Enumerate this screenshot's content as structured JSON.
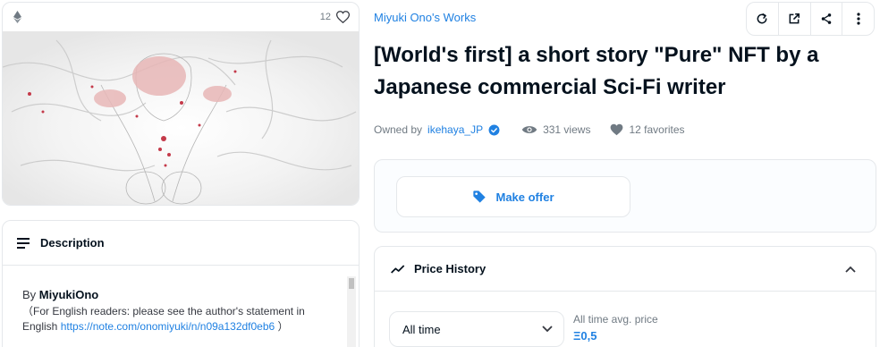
{
  "asset_card": {
    "favorites_count": "12",
    "chain_icon": "ethereum-icon",
    "favorite_icon": "heart-outline-icon"
  },
  "description": {
    "title": "Description",
    "by_prefix": "By",
    "author": "MiyukiOno",
    "note_text": "（For English readers: please see the author's statement in English",
    "link_text": "https://note.com/onomiyuki/n/n09a132df0eb6",
    "note_close": "）"
  },
  "collection": {
    "name": "Miyuki Ono's Works"
  },
  "toolbar": {
    "icons": [
      "refresh-icon",
      "external-link-icon",
      "share-icon",
      "more-vertical-icon"
    ]
  },
  "item": {
    "title": "[World's first] a short story \"Pure\" NFT by a Japanese commercial Sci-Fi writer",
    "owned_by_label": "Owned by",
    "owner": "ikehaya_JP",
    "views": "331 views",
    "favorites": "12 favorites"
  },
  "offer": {
    "button_label": "Make offer"
  },
  "price_history": {
    "title": "Price History",
    "range_selected": "All time",
    "avg_label": "All time avg. price",
    "avg_value": "Ξ0,5"
  },
  "colors": {
    "accent": "#2081e2",
    "border": "#e5e8eb",
    "text": "#04111d",
    "muted": "#707a83"
  }
}
